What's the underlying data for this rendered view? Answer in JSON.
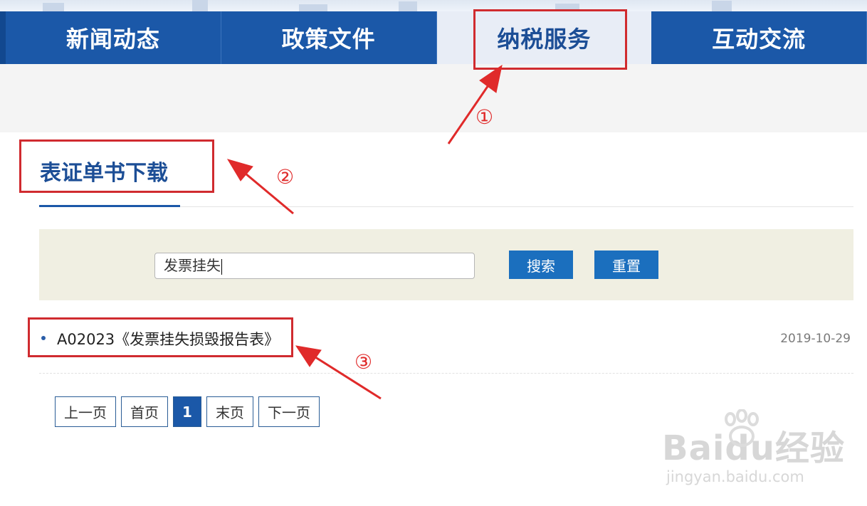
{
  "nav": {
    "items": [
      {
        "label": "新闻动态"
      },
      {
        "label": "政策文件"
      },
      {
        "label": "纳税服务"
      },
      {
        "label": "互动交流"
      }
    ]
  },
  "section": {
    "title": "表证单书下载"
  },
  "search": {
    "value": "发票挂失",
    "search_label": "搜索",
    "reset_label": "重置"
  },
  "results": [
    {
      "title": "A02023《发票挂失损毁报告表》",
      "date": "2019-10-29"
    }
  ],
  "pager": {
    "prev_label": "上一页",
    "first_label": "首页",
    "current": "1",
    "last_label": "末页",
    "next_label": "下一页"
  },
  "annotations": [
    "①",
    "②",
    "③"
  ],
  "watermark": {
    "logo": "Baidu经验",
    "url": "jingyan.baidu.com"
  },
  "colors": {
    "nav_bg": "#1b58a8",
    "accent": "#1c4e96",
    "annotation": "#e02a2a"
  }
}
